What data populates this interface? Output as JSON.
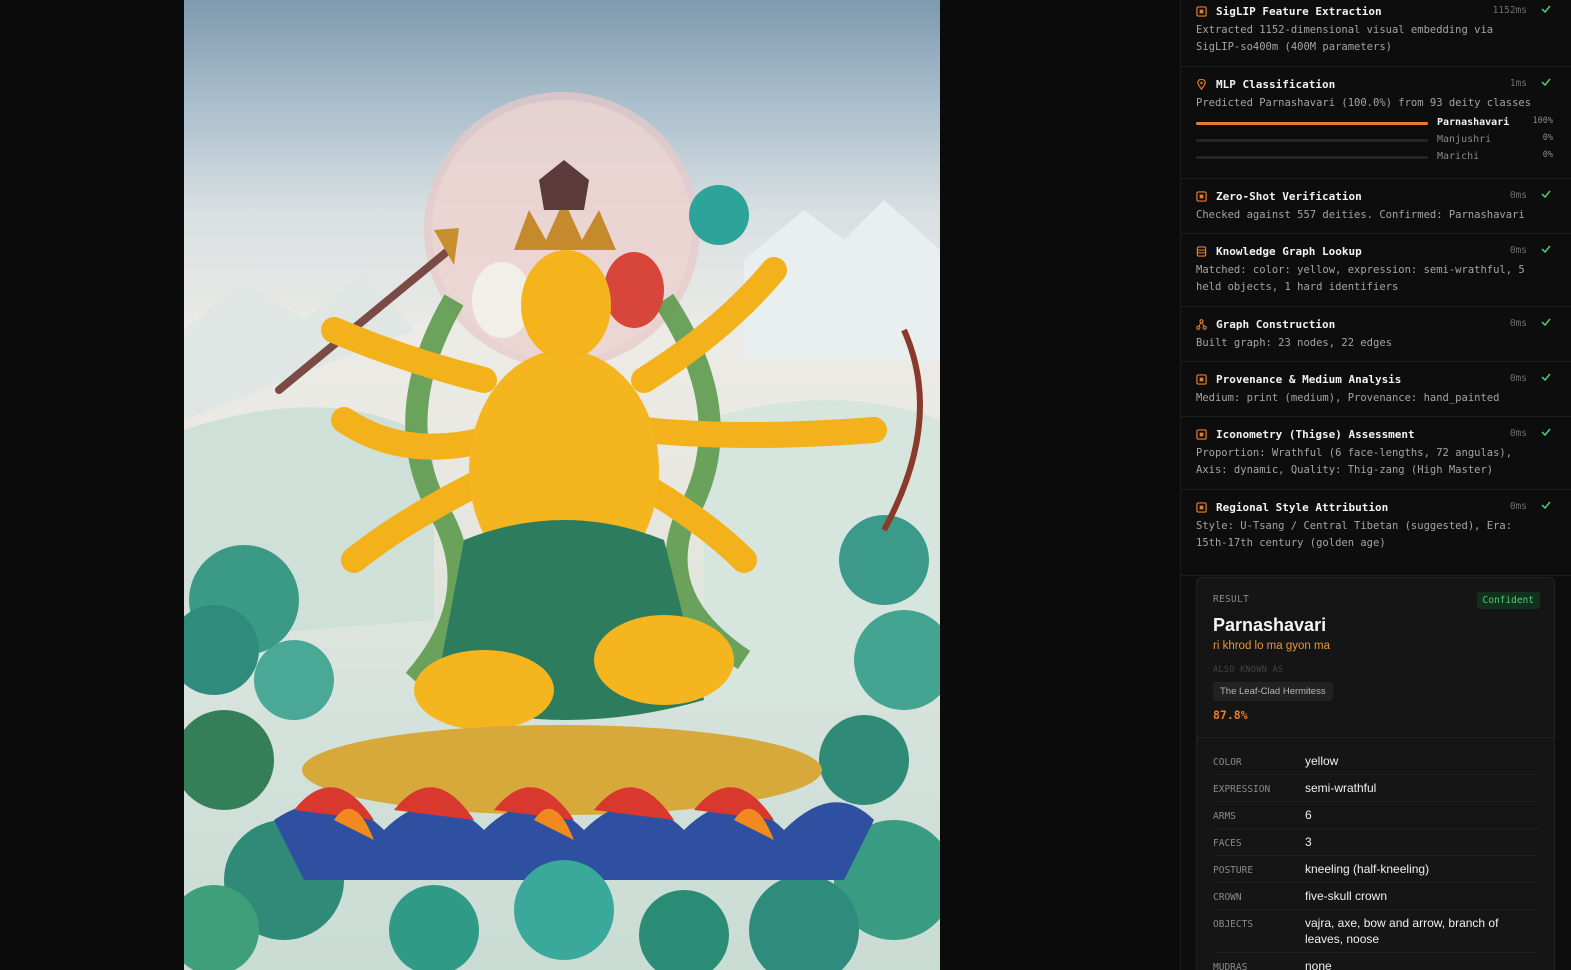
{
  "pipeline": {
    "steps": [
      {
        "title": "SigLIP Feature Extraction",
        "time": "1152ms",
        "icon": "chip-icon",
        "desc": "Extracted 1152-dimensional visual embedding via\nSigLIP-so400m (400M parameters)"
      },
      {
        "title": "MLP Classification",
        "time": "1ms",
        "icon": "pin-icon",
        "desc": "Predicted Parnashavari (100.0%) from 93 deity classes"
      },
      {
        "title": "Zero-Shot Verification",
        "time": "0ms",
        "icon": "chip-icon",
        "desc": "Checked against 557 deities. Confirmed: Parnashavari"
      },
      {
        "title": "Knowledge Graph Lookup",
        "time": "0ms",
        "icon": "database-icon",
        "desc": "Matched: color: yellow, expression: semi-wrathful, 5\nheld objects, 1 hard identifiers"
      },
      {
        "title": "Graph Construction",
        "time": "0ms",
        "icon": "graph-icon",
        "desc": "Built graph: 23 nodes, 22 edges"
      },
      {
        "title": "Provenance & Medium Analysis",
        "time": "0ms",
        "icon": "chip-icon",
        "desc": "Medium: print (medium), Provenance: hand_painted"
      },
      {
        "title": "Iconometry (Thigse) Assessment",
        "time": "0ms",
        "icon": "chip-icon",
        "desc": "Proportion: Wrathful (6 face-lengths, 72 angulas),\nAxis: dynamic, Quality: Thig-zang (High Master)"
      },
      {
        "title": "Regional Style Attribution",
        "time": "0ms",
        "icon": "chip-icon",
        "desc": "Style: U-Tsang / Central Tibetan (suggested), Era:\n15th-17th century (golden age)"
      }
    ],
    "predictions": [
      {
        "label": "Parnashavari",
        "pct": "100%",
        "value": 1.0
      },
      {
        "label": "Manjushri",
        "pct": "0%",
        "value": 0.0
      },
      {
        "label": "Marichi",
        "pct": "0%",
        "value": 0.0
      }
    ]
  },
  "result": {
    "label": "RESULT",
    "badge": "Confident",
    "name": "Parnashavari",
    "tibetan": "ri khrod lo ma gyon ma",
    "aka_label": "ALSO KNOWN AS",
    "aka": "The Leaf-Clad Hermitess",
    "score": "87.8%",
    "attributes": [
      {
        "key": "COLOR",
        "value": "yellow"
      },
      {
        "key": "EXPRESSION",
        "value": "semi-wrathful"
      },
      {
        "key": "ARMS",
        "value": "6"
      },
      {
        "key": "FACES",
        "value": "3"
      },
      {
        "key": "POSTURE",
        "value": "kneeling (half-kneeling)"
      },
      {
        "key": "CROWN",
        "value": "five-skull crown"
      },
      {
        "key": "OBJECTS",
        "value": "vajra, axe, bow and arrow, branch of leaves, noose"
      },
      {
        "key": "MUDRAS",
        "value": "none"
      }
    ]
  },
  "colors": {
    "accent": "#ee7b2a",
    "confident": "#43d17a",
    "check": "#43d17a"
  }
}
